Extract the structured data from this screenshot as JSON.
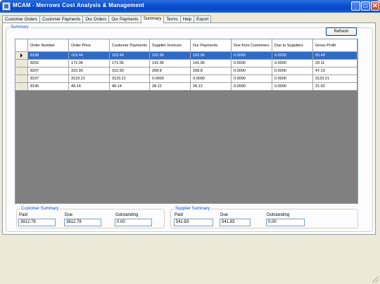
{
  "window": {
    "title": "MCAM - Merrows Cost Analysis & Management",
    "minimize_glyph": "_",
    "maximize_glyph": "□",
    "close_glyph": "✕"
  },
  "tabs": [
    {
      "label": "Customer Orders"
    },
    {
      "label": "Customer Payments"
    },
    {
      "label": "Our Orders"
    },
    {
      "label": "Our Payments"
    },
    {
      "label": "Summary",
      "active": true
    },
    {
      "label": "Terms"
    },
    {
      "label": "Help"
    },
    {
      "label": "Export"
    }
  ],
  "summary": {
    "group_label": "Summary",
    "refresh_label": "Refresh",
    "columns": [
      "Order Number",
      "Order Price",
      "Customer Payments",
      "Supplier Invoices",
      "Our Payments",
      "Due from Customers",
      "Due to Suppliers",
      "Gross Profit"
    ],
    "rows": [
      [
        "8198",
        "153.44",
        "153.44",
        "102.96",
        "102.96",
        "0.0000",
        "0.0000",
        "50.48"
      ],
      [
        "8202",
        "171.06",
        "171.06",
        "141.95",
        "141.95",
        "0.0000",
        "0.0000",
        "29.11"
      ],
      [
        "8207",
        "315.93",
        "315.93",
        "268.8",
        "268.8",
        "0.0000",
        "0.0000",
        "47.13"
      ],
      [
        "8197",
        "3123.21",
        "3123.21",
        "0.0000",
        "0.0000",
        "0.0000",
        "0.0000",
        "3123.21"
      ],
      [
        "8196",
        "49.14",
        "49.14",
        "28.12",
        "28.12",
        "0.0000",
        "0.0000",
        "21.02"
      ]
    ],
    "selected_row": 0
  },
  "customer_summary": {
    "label": "Customer Summary",
    "paid_label": "Paid",
    "paid_value": "3812.78",
    "due_label": "Due",
    "due_value": "3812.78",
    "outstanding_label": "Outstanding",
    "outstanding_value": "0.00"
  },
  "supplier_summary": {
    "label": "Supplier Summary",
    "paid_label": "Paid",
    "paid_value": "541.83",
    "due_label": "Due",
    "due_value": "541.83",
    "outstanding_label": "Outstanding",
    "outstanding_value": "0.00"
  },
  "colors": {
    "title_bar": "#0a4fd0",
    "selection": "#316ac5",
    "group_label": "#0046d5",
    "active_tab_accent": "#ffc83c"
  }
}
